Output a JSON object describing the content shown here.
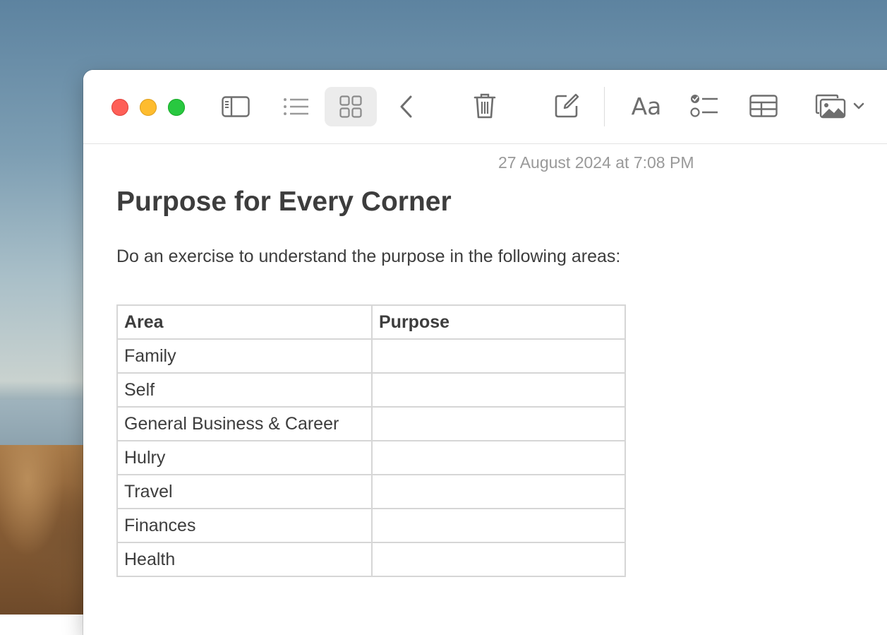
{
  "toolbar": {
    "icons": [
      "sidebar-icon",
      "list-view-icon",
      "gallery-view-icon",
      "chevron-left-icon",
      "trash-icon",
      "compose-icon",
      "format-text-icon",
      "checklist-icon",
      "table-icon",
      "media-icon",
      "chevron-down-icon"
    ],
    "format_label": "Aa",
    "active_view": "gallery"
  },
  "note": {
    "date": "27 August 2024 at 7:08 PM",
    "title": "Purpose for Every Corner",
    "body": "Do an exercise to understand the purpose in the following areas:",
    "table": {
      "headers": [
        "Area",
        "Purpose"
      ],
      "rows": [
        [
          "Family",
          ""
        ],
        [
          "Self",
          ""
        ],
        [
          "General Business & Career",
          ""
        ],
        [
          "Hulry",
          ""
        ],
        [
          "Travel",
          ""
        ],
        [
          "Finances",
          ""
        ],
        [
          "Health",
          ""
        ]
      ]
    }
  },
  "colors": {
    "close": "#fe5f57",
    "minimize": "#febc2e",
    "maximize": "#28c840",
    "text": "#3d3d3d",
    "date": "#999999"
  }
}
